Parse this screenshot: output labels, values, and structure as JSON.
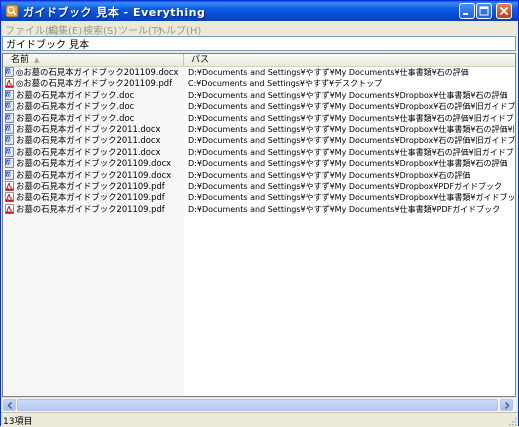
{
  "window": {
    "title": "ガイドブック 見本 - Everything",
    "min_icon": "minimize-icon",
    "max_icon": "maximize-icon",
    "close_icon": "close-icon"
  },
  "menu": [
    "ファイル(F)",
    "編集(E)",
    "検索(S)",
    "ツール(T)",
    "ヘルプ(H)"
  ],
  "search": {
    "value": "ガイドブック 見本"
  },
  "columns": {
    "name": "名前",
    "path": "パス"
  },
  "rows": [
    {
      "icon": "word-doc-icon",
      "name": "◎お墓の石見本ガイドブック201109.docx",
      "path": "D:¥Documents and Settings¥やすず¥My Documents¥仕事書類¥石の評価"
    },
    {
      "icon": "pdf-icon",
      "name": "◎お墓の石見本ガイドブック201109.pdf",
      "path": "C:¥Documents and Settings¥やすず¥デスクトップ"
    },
    {
      "icon": "word-doc-icon",
      "name": "お墓の石見本ガイドブック.doc",
      "path": "D:¥Documents and Settings¥やすず¥My Documents¥Dropbox¥仕事書類¥石の評価"
    },
    {
      "icon": "word-doc-icon",
      "name": "お墓の石見本ガイドブック.doc",
      "path": "D:¥Documents and Settings¥やすず¥My Documents¥Dropbox¥石の評価¥旧ガイドブック"
    },
    {
      "icon": "word-doc-icon",
      "name": "お墓の石見本ガイドブック.doc",
      "path": "D:¥Documents and Settings¥やすず¥My Documents¥仕事書類¥石の評価¥旧ガイドブック"
    },
    {
      "icon": "word-doc-icon",
      "name": "お墓の石見本ガイドブック2011.docx",
      "path": "D:¥Documents and Settings¥やすず¥My Documents¥Dropbox¥仕事書類¥石の評価¥旧ガイドブック"
    },
    {
      "icon": "word-doc-icon",
      "name": "お墓の石見本ガイドブック2011.docx",
      "path": "D:¥Documents and Settings¥やすず¥My Documents¥Dropbox¥石の評価¥旧ガイドブック"
    },
    {
      "icon": "word-doc-icon",
      "name": "お墓の石見本ガイドブック2011.docx",
      "path": "D:¥Documents and Settings¥やすず¥My Documents¥仕事書類¥石の評価¥旧ガイドブック"
    },
    {
      "icon": "word-doc-icon",
      "name": "お墓の石見本ガイドブック201109.docx",
      "path": "D:¥Documents and Settings¥やすず¥My Documents¥Dropbox¥仕事書類¥石の評価"
    },
    {
      "icon": "word-doc-icon",
      "name": "お墓の石見本ガイドブック201109.docx",
      "path": "D:¥Documents and Settings¥やすず¥My Documents¥Dropbox¥石の評価"
    },
    {
      "icon": "pdf-icon",
      "name": "お墓の石見本ガイドブック201109.pdf",
      "path": "D:¥Documents and Settings¥やすず¥My Documents¥Dropbox¥PDFガイドブック"
    },
    {
      "icon": "pdf-icon",
      "name": "お墓の石見本ガイドブック201109.pdf",
      "path": "D:¥Documents and Settings¥やすず¥My Documents¥Dropbox¥仕事書類¥ガイドブック"
    },
    {
      "icon": "pdf-icon",
      "name": "お墓の石見本ガイドブック201109.pdf",
      "path": "D:¥Documents and Settings¥やすず¥My Documents¥仕事書類¥PDFガイドブック"
    }
  ],
  "status": {
    "count": "13項目"
  }
}
